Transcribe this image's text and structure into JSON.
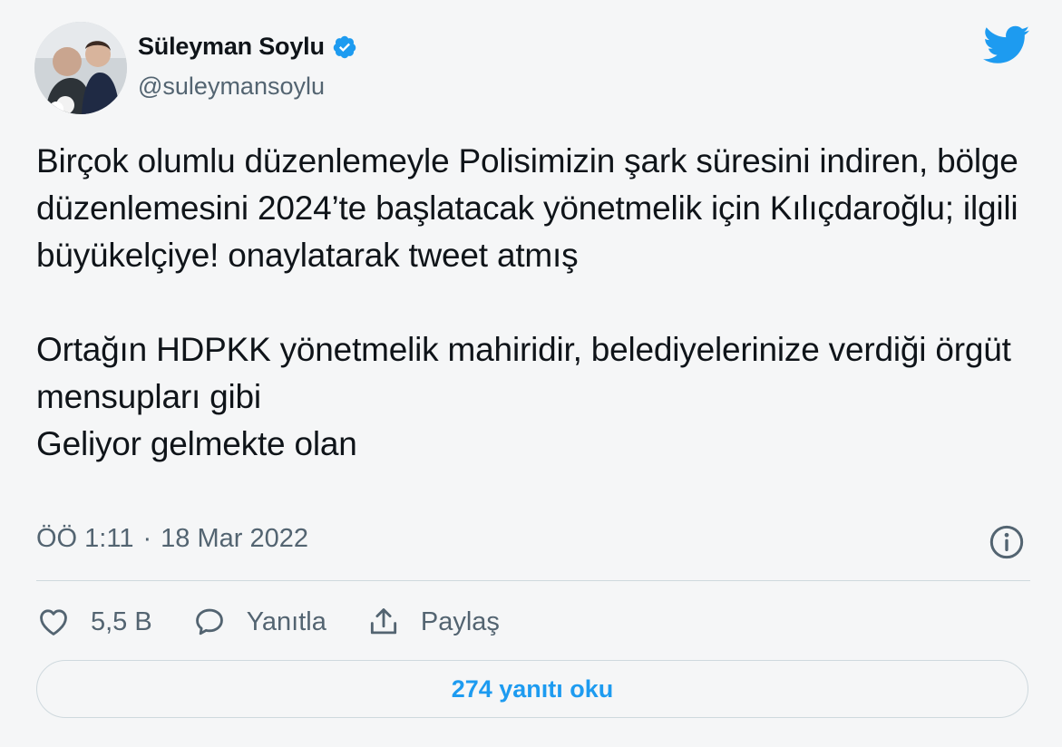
{
  "author": {
    "name": "Süleyman Soylu",
    "handle": "@suleymansoylu",
    "verified": true
  },
  "tweet": {
    "paragraph1": "Birçok olumlu düzenlemeyle Polisimizin şark süresini indiren, bölge düzenlemesini 2024’te başlatacak yönetmelik için Kılıçdaroğlu; ilgili büyükelçiye! onaylatarak tweet atmış",
    "paragraph2_line1": "Ortağın HDPKK yönetmelik mahiridir, belediyelerinize verdiği örgüt mensupları gibi",
    "paragraph2_line2": "Geliyor gelmekte olan"
  },
  "meta": {
    "time": "ÖÖ 1:11",
    "separator": "·",
    "date": "18 Mar 2022"
  },
  "actions": {
    "like_count": "5,5 B",
    "reply_label": "Yanıtla",
    "share_label": "Paylaş"
  },
  "read_replies": "274 yanıtı oku",
  "icons": [
    "verified-badge-icon",
    "twitter-bird-icon",
    "info-icon",
    "heart-icon",
    "reply-bubble-icon",
    "share-icon"
  ],
  "colors": {
    "accent": "#1d9bf0",
    "text": "#0f1419",
    "secondary_text": "#536471",
    "background": "#f5f6f7",
    "border": "#cfd9de"
  }
}
